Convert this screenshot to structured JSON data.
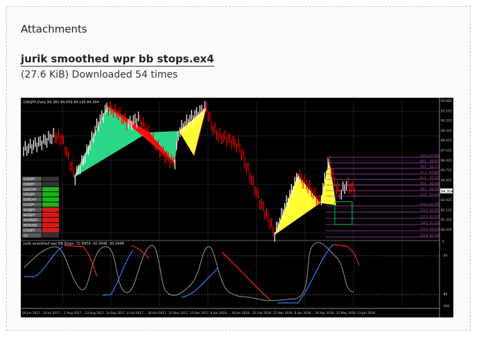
{
  "attachments": {
    "heading": "Attachments",
    "file_name": "jurik smoothed wpr bb stops.ex4",
    "file_meta": "(27.6 KiB) Downloaded 54 times"
  },
  "screenshot": {
    "symbol_header": "CADJPY,Daily  84.381 84.459 84.105 84.304",
    "price_labels": [
      "92.655",
      "91.125",
      "90.225",
      "89.325",
      "88.425",
      "87.525",
      "86.625",
      "85.725",
      "84.825",
      "83.925",
      "83.025",
      "82.125",
      "81.225",
      "80.325"
    ],
    "current_price": "84.304",
    "fib_levels_upper": [
      {
        "ratio": "Swing",
        "price": "87.091"
      },
      {
        "ratio": "88.6",
        "price": "86.413"
      },
      {
        "ratio": "78.6",
        "price": "86.213"
      },
      {
        "ratio": "70.7",
        "price": "85.866"
      },
      {
        "ratio": "61.8",
        "price": "85.532"
      },
      {
        "ratio": "50.0",
        "price": "85.036"
      },
      {
        "ratio": "38.2",
        "price": "84.556"
      },
      {
        "ratio": "23.6",
        "price": "83.920"
      }
    ],
    "fib_levels_lower": [
      {
        "ratio": "Swing",
        "price": "82.995"
      },
      {
        "ratio": "113.0",
        "price": "82.451"
      },
      {
        "ratio": "127.2",
        "price": "82.017"
      },
      {
        "ratio": "138.2",
        "price": "81.435"
      },
      {
        "ratio": "150.0",
        "price": "80.934"
      },
      {
        "ratio": "161.8",
        "price": "80.449"
      }
    ],
    "currency_panel": [
      {
        "pair": "EURJPY",
        "state": "none"
      },
      {
        "pair": "GBPJPY",
        "state": "none"
      },
      {
        "pair": "USDCHF",
        "state": "green"
      },
      {
        "pair": "USDJPY",
        "state": "green"
      },
      {
        "pair": "EURCHF",
        "state": "green"
      },
      {
        "pair": "CHFJPY",
        "state": "green"
      },
      {
        "pair": "AUDJPY",
        "state": "red"
      },
      {
        "pair": "NZDJPY",
        "state": "red"
      },
      {
        "pair": "AUDNZD",
        "state": "red"
      },
      {
        "pair": "NZDUSD",
        "state": "red"
      },
      {
        "pair": "CADJPY",
        "state": "red"
      },
      {
        "pair": "D1",
        "state": "none"
      }
    ],
    "indicator_header": "Jurik smoothed wpr BB Stops -72.8459 -30.3448 -30.3448",
    "indicator_scale": [
      "0",
      "-20",
      "-80",
      "-100"
    ],
    "date_labels": [
      "16 Jun 2017",
      "10 Jul 2017",
      "1 Aug 2017",
      "23 Aug 2017",
      "14 Sep 2017",
      "6 Oct 2017",
      "30 Oct 2017",
      "21 Nov 2017",
      "13 Dec 2017",
      "8 Jan 2018",
      "30 Jan 2018",
      "21 Feb 2018",
      "15 Mar 2018",
      "6 Apr 2018",
      "30 Apr 2018",
      "22 May 2018",
      "13 Jun 2018"
    ],
    "colors": {
      "bull": "#ffffff",
      "bear": "#ff0000",
      "pattern_green": "#2bd888",
      "pattern_yellow": "#ffff33",
      "pattern_red": "#ff0000",
      "fib": "#b04cb0",
      "stop_blue": "#2a7fff",
      "stop_red": "#ff2020",
      "wpr": "#9a9a9a"
    }
  }
}
